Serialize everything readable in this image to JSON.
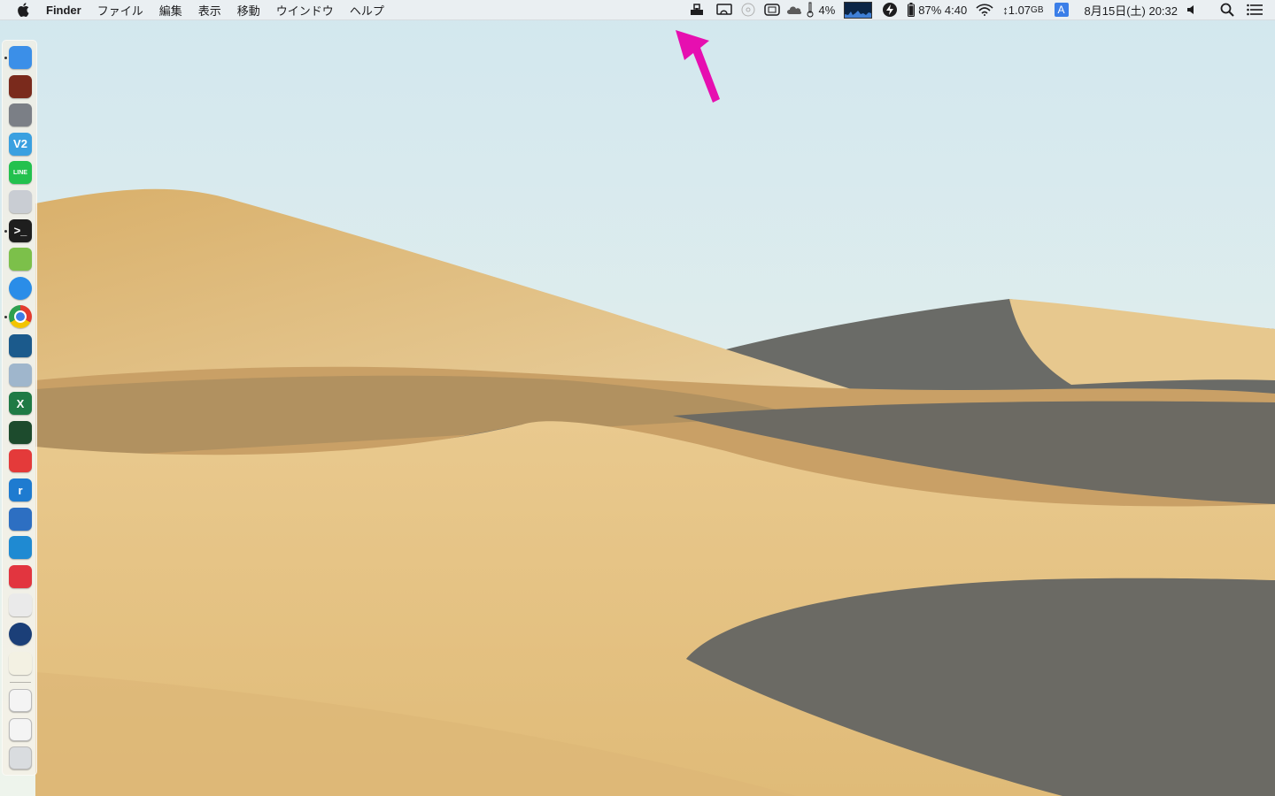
{
  "menubar": {
    "app_name": "Finder",
    "menus": [
      "ファイル",
      "編集",
      "表示",
      "移動",
      "ウインドウ",
      "ヘルプ"
    ],
    "status": {
      "cpu_percent": "4%",
      "battery": "87% 4:40",
      "network": "↕1.07",
      "network_unit": "GB",
      "input_source": "A",
      "datetime": "8月15日(土) 20:32"
    }
  },
  "dock": {
    "apps": [
      {
        "name": "finder",
        "label": "",
        "color": "#3b8fe8",
        "running": true
      },
      {
        "name": "photo-booth",
        "label": "",
        "color": "#7a2a1c",
        "running": false
      },
      {
        "name": "system-preferences",
        "label": "",
        "color": "#7b7f86",
        "running": false
      },
      {
        "name": "vectorworks",
        "label": "V2",
        "color": "#3aa0e0",
        "running": false
      },
      {
        "name": "line",
        "label": "LINE",
        "color": "#23c14e",
        "running": false
      },
      {
        "name": "preview",
        "label": "",
        "color": "#c9cdd3",
        "running": false
      },
      {
        "name": "terminal",
        "label": ">_",
        "color": "#1e1e1e",
        "running": true
      },
      {
        "name": "notes-green",
        "label": "",
        "color": "#7cc04a",
        "running": false
      },
      {
        "name": "safari",
        "label": "",
        "color": "#2a8de8",
        "running": false
      },
      {
        "name": "chrome",
        "label": "",
        "color": "#e9e9e9",
        "running": true
      },
      {
        "name": "reader",
        "label": "",
        "color": "#1b5a8c",
        "running": false
      },
      {
        "name": "remote-desktop",
        "label": "",
        "color": "#9fb6cc",
        "running": false
      },
      {
        "name": "excel",
        "label": "X",
        "color": "#1f7a45",
        "running": false
      },
      {
        "name": "grapher",
        "label": "",
        "color": "#1d4b2d",
        "running": false
      },
      {
        "name": "no-entry",
        "label": "",
        "color": "#e43a3a",
        "running": false
      },
      {
        "name": "radiko",
        "label": "r",
        "color": "#1e7bd0",
        "running": false
      },
      {
        "name": "files-app",
        "label": "",
        "color": "#2d6fc2",
        "running": false
      },
      {
        "name": "vscode",
        "label": "",
        "color": "#1f8ad2",
        "running": false
      },
      {
        "name": "xmind",
        "label": "",
        "color": "#e2353f",
        "running": false
      },
      {
        "name": "installer",
        "label": "",
        "color": "#eaeaea",
        "running": false
      },
      {
        "name": "quicktime",
        "label": "",
        "color": "#1b3f78",
        "running": false
      },
      {
        "name": "stickies",
        "label": "",
        "color": "#f3f1e3",
        "running": false
      }
    ],
    "others": [
      {
        "name": "document",
        "color": "#f4f4f4"
      },
      {
        "name": "downloads",
        "color": "#f4f4f4"
      },
      {
        "name": "trash",
        "color": "#d9dcdf"
      }
    ]
  },
  "colors": {
    "annotation_arrow": "#e60fb0",
    "sky": "#dcedf1",
    "sand": "#e0bd7a",
    "shadow": "#6c6a63"
  }
}
